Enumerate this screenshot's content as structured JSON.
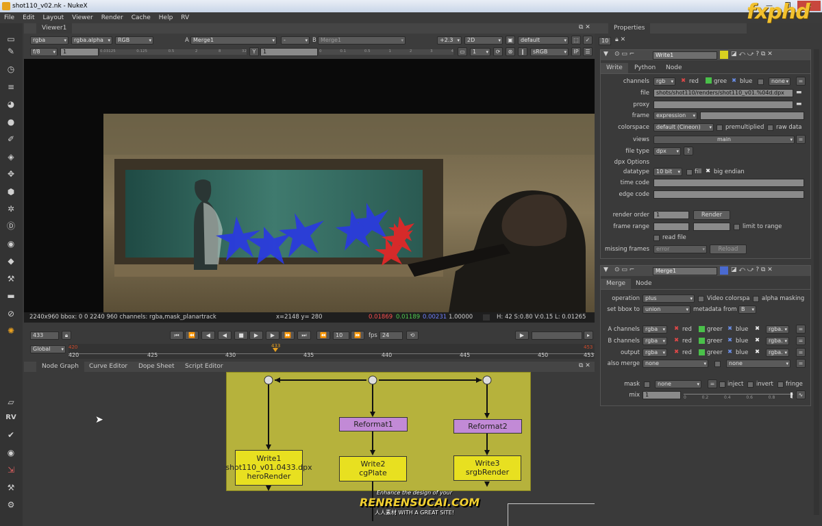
{
  "window": {
    "title": "shot110_v02.nk - NukeX",
    "min": "—",
    "max": "❐",
    "close": "✕"
  },
  "menu": [
    "File",
    "Edit",
    "Layout",
    "Viewer",
    "Render",
    "Cache",
    "Help",
    "RV"
  ],
  "viewer": {
    "tab": "Viewer1",
    "channels": "rgba",
    "alpha": "rgba.alpha",
    "display": "RGB",
    "a_label": "A",
    "a_input": "Merge1",
    "op": "-",
    "b_label": "B",
    "b_input": "Merge1",
    "gain": "+2.3",
    "mode": "2D",
    "lut": "default",
    "fstop": "f/8",
    "exposure": "1",
    "y_label": "Y",
    "y_value": "1",
    "frame_field": "1",
    "cs": "sRGB",
    "ruler": [
      "0.03125",
      "0.125",
      "0.5",
      "2",
      "8",
      "32"
    ],
    "ruler2": [
      "0",
      "0.1",
      "0.5",
      "1",
      "2",
      "3",
      "4"
    ],
    "info_left": "2240x960 bbox: 0 0 2240 960 channels: rgba,mask_planartrack",
    "info_xy": "x=2148 y= 280",
    "info_r": "0.01869",
    "info_g": "0.01189",
    "info_b": "0.00231",
    "info_a": "1.00000",
    "info_hsv": "H: 42 S:0.80 V:0.15  L: 0.01265"
  },
  "timeline": {
    "current_frame": "433",
    "step": "10",
    "fps_label": "fps",
    "fps": "24",
    "range": "Global",
    "ticks": [
      "420",
      "425",
      "430",
      "435",
      "440",
      "445",
      "450",
      "453"
    ],
    "start_marker": "420",
    "current_marker": "433",
    "end_marker": "453"
  },
  "node_panel": {
    "tabs": [
      "Node Graph",
      "Curve Editor",
      "Dope Sheet",
      "Script Editor"
    ],
    "nodes": {
      "write1": [
        "Write1",
        "shot110_v01.0433.dpx",
        "heroRender"
      ],
      "reformat1": "Reformat1",
      "reformat2": "Reformat2",
      "write2": [
        "Write2",
        "cgPlate"
      ],
      "write3": [
        "Write3",
        "srgbRender"
      ]
    },
    "watermark": {
      "top": "Enhance the design of your",
      "main": "RENRENSUCAI.COM",
      "sub": "人人素材  WITH A GREAT SITE!"
    }
  },
  "logo": "fxphd",
  "properties": {
    "title": "Properties",
    "max_nodes": "10",
    "write": {
      "name": "Write1",
      "tabs": [
        "Write",
        "Python",
        "Node"
      ],
      "channels_label": "channels",
      "channels": "rgb",
      "red": "red",
      "green": "gree",
      "blue": "blue",
      "none": "none",
      "file_label": "file",
      "file": "shots/shot110/renders/shot110_v01.%04d.dpx",
      "proxy_label": "proxy",
      "frame_label": "frame",
      "frame": "expression",
      "colorspace_label": "colorspace",
      "colorspace": "default (Cineon)",
      "premult": "premultiplied",
      "raw": "raw data",
      "views_label": "views",
      "views": "main",
      "filetype_label": "file type",
      "filetype": "dpx",
      "help": "?",
      "dpx_options": "dpx Options",
      "datatype_label": "datatype",
      "datatype": "10 bit",
      "fill": "fill",
      "big_endian": "big endian",
      "timecode_label": "time code",
      "edgecode_label": "edge code",
      "render_order_label": "render order",
      "render_order": "1",
      "render_btn": "Render",
      "frame_range_label": "frame range",
      "limit": "limit to range",
      "read_file": "read file",
      "missing_label": "missing frames",
      "missing": "error",
      "reload": "Reload"
    },
    "merge": {
      "name": "Merge1",
      "tabs": [
        "Merge",
        "Node"
      ],
      "operation_label": "operation",
      "operation": "plus",
      "video_cs": "Video colorspa",
      "alpha_masking": "alpha masking",
      "bbox_label": "set bbox to",
      "bbox": "union",
      "metadata_label": "metadata from",
      "metadata": "B",
      "a_label": "A channels",
      "b_label": "B channels",
      "out_label": "output",
      "chan": "rgba",
      "alpha": "rgba.",
      "red": "red",
      "green": "greer",
      "blue": "blue",
      "also_label": "also merge",
      "also": "none",
      "also2": "none",
      "mask_label": "mask",
      "mask": "none",
      "inject": "inject",
      "invert": "invert",
      "fringe": "fringe",
      "mix_label": "mix",
      "mix": "1",
      "mix_ticks": [
        "0",
        "0.2",
        "0.4",
        "0.6",
        "0.8",
        "1"
      ]
    }
  },
  "left_tools": [
    "RV"
  ]
}
